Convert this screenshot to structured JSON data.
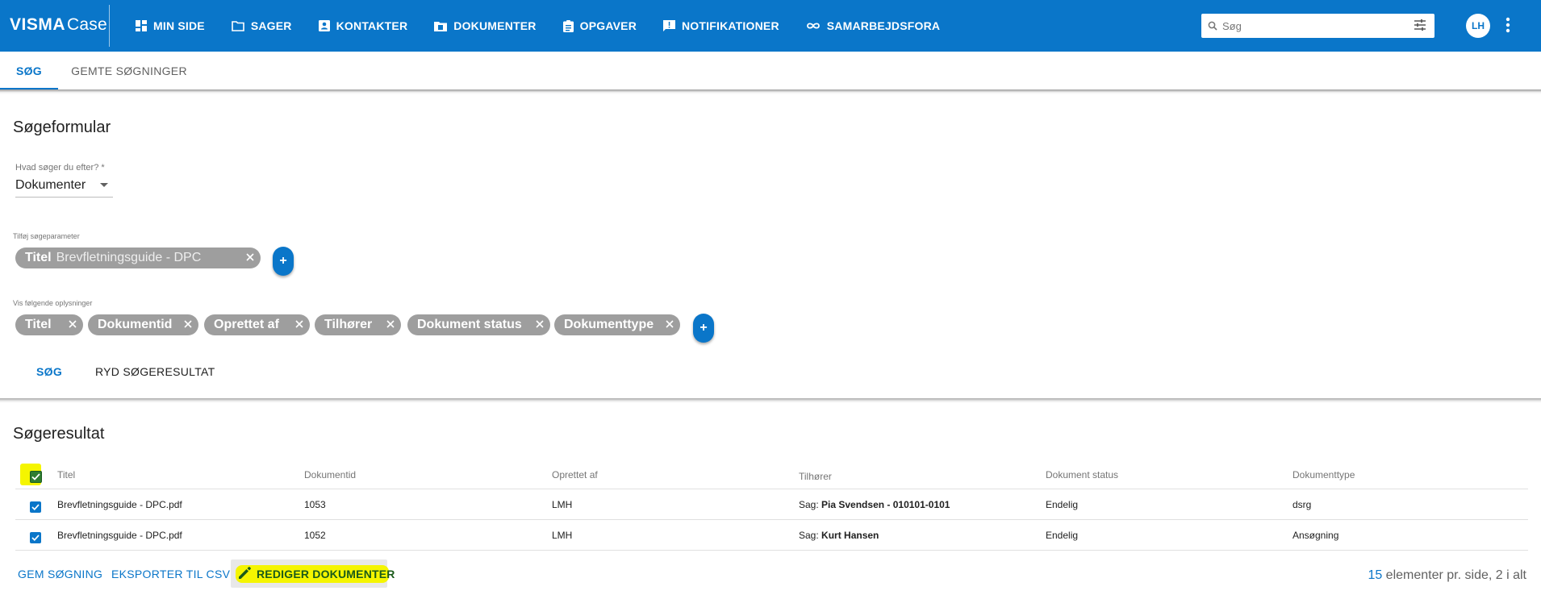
{
  "topbar": {
    "brand_bold": "VISMA",
    "brand_light": "Case",
    "nav": [
      {
        "label": "MIN SIDE",
        "icon": "dashboard-icon"
      },
      {
        "label": "SAGER",
        "icon": "folder-icon"
      },
      {
        "label": "KONTAKTER",
        "icon": "contact-icon"
      },
      {
        "label": "DOKUMENTER",
        "icon": "document-folder-icon"
      },
      {
        "label": "OPGAVER",
        "icon": "clipboard-icon"
      },
      {
        "label": "NOTIFIKATIONER",
        "icon": "notification-icon"
      },
      {
        "label": "SAMARBEJDSFORA",
        "icon": "infinity-icon"
      }
    ],
    "search_placeholder": "Søg",
    "avatar": "LH"
  },
  "tabs": {
    "search": "SØG",
    "saved": "GEMTE SØGNINGER"
  },
  "form": {
    "title": "Søgeformular",
    "what_label": "Hvad søger du efter? *",
    "what_value": "Dokumenter",
    "params_label": "Tilføj søgeparameter",
    "param_chip": {
      "key": "Titel",
      "value": "Brevfletningsguide - DPC"
    },
    "info_label": "Vis følgende oplysninger",
    "info_chips": [
      "Titel",
      "Dokumentid",
      "Oprettet af",
      "Tilhører",
      "Dokument status",
      "Dokumenttype"
    ],
    "search_button": "SØG",
    "clear_button": "RYD SØGERESULTAT"
  },
  "results": {
    "title": "Søgeresultat",
    "columns": [
      "Titel",
      "Dokumentid",
      "Oprettet af",
      "Tilhører",
      "Dokument status",
      "Dokumenttype"
    ],
    "rows": [
      {
        "title": "Brevfletningsguide - DPC.pdf",
        "id": "1053",
        "created_by": "LMH",
        "belongs_prefix": "Sag:",
        "belongs_name": "Pia Svendsen - 010101-0101",
        "status": "Endelig",
        "type": "dsrg"
      },
      {
        "title": "Brevfletningsguide - DPC.pdf",
        "id": "1052",
        "created_by": "LMH",
        "belongs_prefix": "Sag:",
        "belongs_name": "Kurt Hansen",
        "status": "Endelig",
        "type": "Ansøgning"
      }
    ],
    "save_search": "GEM SØGNING",
    "export_csv": "EKSPORTER TIL CSV",
    "edit_documents": "REDIGER DOKUMENTER",
    "page_size": "15",
    "pager_text": " elementer pr. side, 2 i alt"
  },
  "colors": {
    "brand_blue": "#0a76c9",
    "highlight_yellow": "#f5f500",
    "chip_gray": "#9e9e9e"
  }
}
